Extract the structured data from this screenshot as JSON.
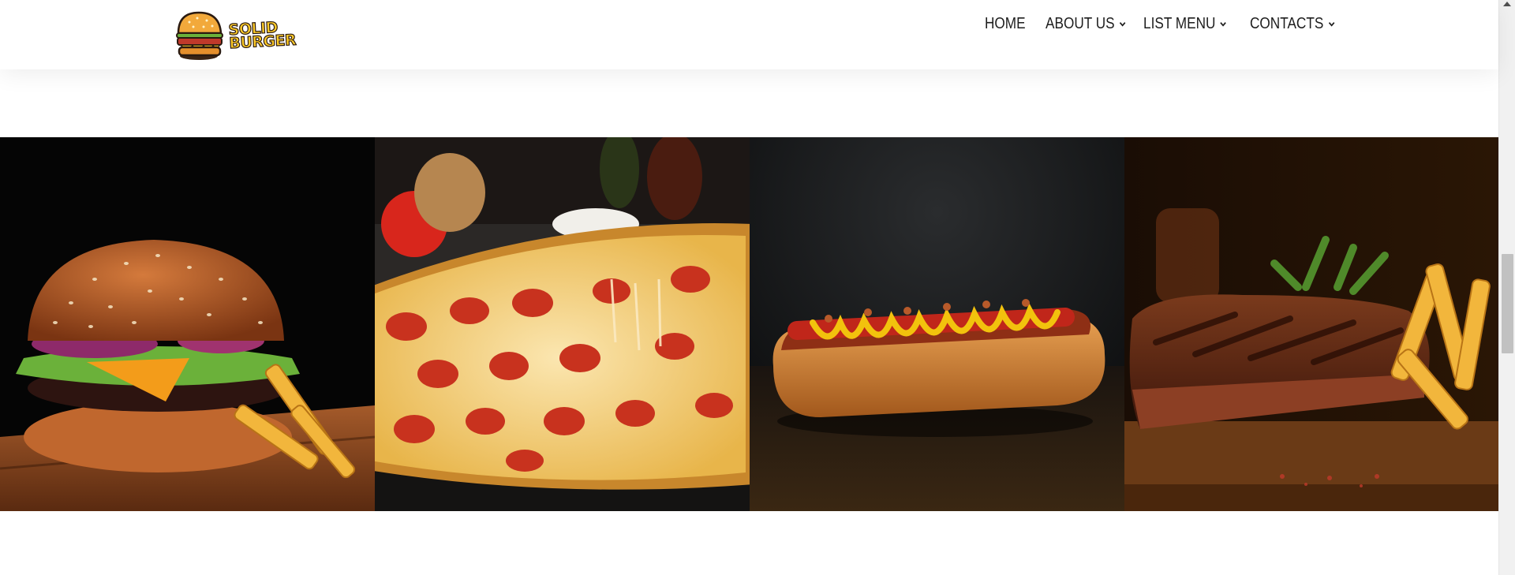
{
  "header": {
    "logo": {
      "line1": "SOLID",
      "line2": "BURGER"
    },
    "nav": [
      {
        "label": "HOME",
        "has_dropdown": false
      },
      {
        "label": "ABOUT US",
        "has_dropdown": true
      },
      {
        "label": "LIST MENU",
        "has_dropdown": true
      },
      {
        "label": "CONTACTS",
        "has_dropdown": true
      }
    ]
  },
  "gallery": {
    "images": [
      {
        "subject": "burger-with-fries"
      },
      {
        "subject": "pepperoni-pizza"
      },
      {
        "subject": "hot-dog"
      },
      {
        "subject": "grilled-steak-with-fries"
      }
    ]
  },
  "colors": {
    "logo_yellow": "#ffcc29",
    "nav_text": "#1e1e1e",
    "header_bg": "#ffffff"
  }
}
